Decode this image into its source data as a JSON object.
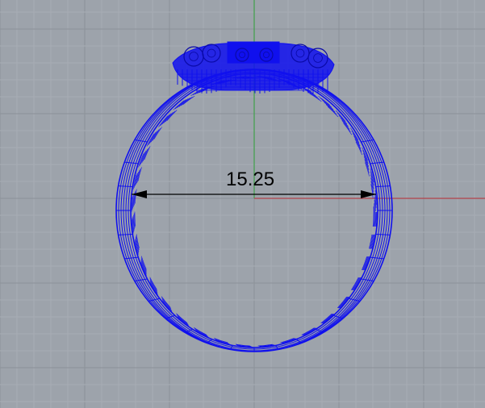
{
  "viewport": {
    "background": "#9da3ab",
    "grid_minor_color": "#a8adb4",
    "grid_major_color": "#8b9198",
    "x_axis_color": "#b3414a",
    "y_axis_color": "#3ea04a",
    "wire_color": "#1010ee"
  },
  "dimension": {
    "value_text": "15.25"
  }
}
